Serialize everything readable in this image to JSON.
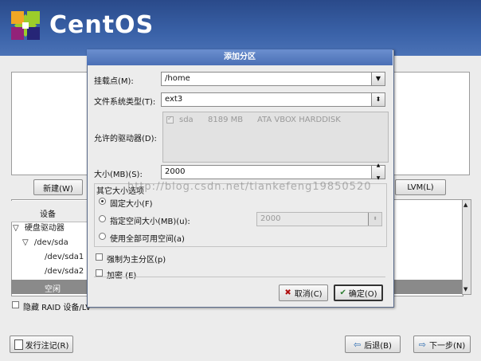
{
  "banner": {
    "logo_text": "CentOS"
  },
  "background": {
    "new_button": "新建(W)",
    "lvm_button": "LVM(L)",
    "tree_header": "设备",
    "tree_items": [
      {
        "label": "硬盘驱动器",
        "expander": "▽"
      },
      {
        "label": "/dev/sda",
        "expander": "▽"
      },
      {
        "label": "/dev/sda1",
        "expander": ""
      },
      {
        "label": "/dev/sda2",
        "expander": ""
      }
    ],
    "free_space": "空闲",
    "hide_raid_label": "隐藏 RAID 设备/LV",
    "release_notes_button": "发行注记(R)",
    "back_button": "后退(B)",
    "next_button": "下一步(N)"
  },
  "dialog": {
    "title": "添加分区",
    "mount_point_label": "挂载点(M):",
    "mount_point_value": "/home",
    "fs_type_label": "文件系统类型(T):",
    "fs_type_value": "ext3",
    "drives_label": "允许的驱动器(D):",
    "drive": {
      "name": "sda",
      "size": "8189 MB",
      "model": "ATA VBOX HARDDISK",
      "checked": true
    },
    "size_label": "大小(MB)(S):",
    "size_value": "2000",
    "size_options_title": "其它大小选项",
    "option_fixed": "固定大小(F)",
    "option_upto": "指定空间大小(MB)(u):",
    "option_upto_value": "2000",
    "option_fill": "使用全部可用空间(a)",
    "force_primary_label": "强制为主分区(p)",
    "encrypt_label": "加密 (E)",
    "cancel_button": "取消(C)",
    "ok_button": "确定(O)",
    "watermark": "http://blog.csdn.net/tiankefeng19850520"
  },
  "colors": {
    "banner": "#3a62a8",
    "title_bar": "#5a7fc2",
    "free_row": "#8a8a8a"
  }
}
